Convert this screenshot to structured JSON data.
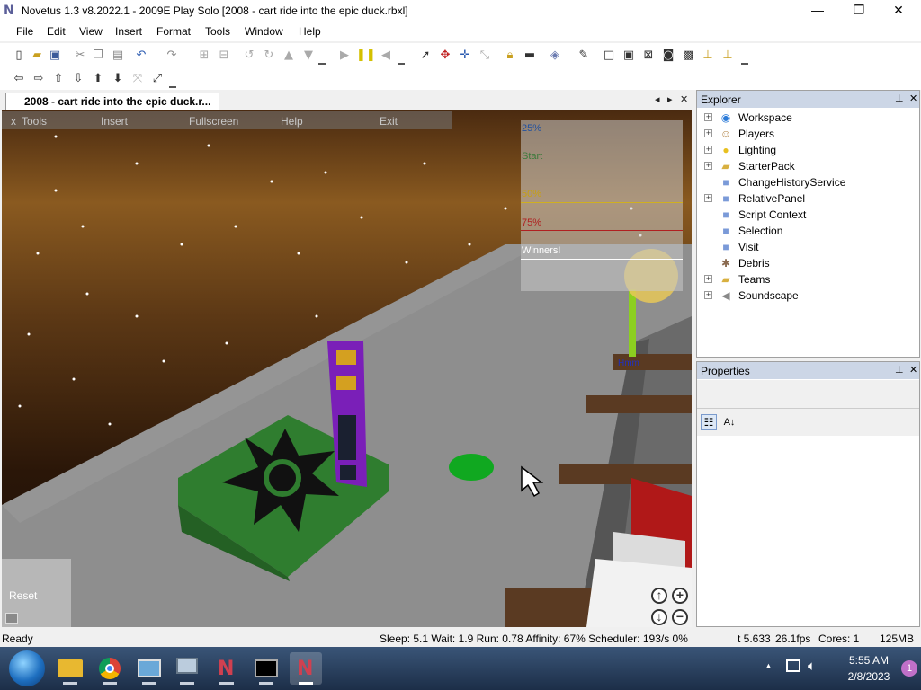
{
  "window": {
    "title": "Novetus 1.3 v8.2022.1 - 2009E Play Solo [2008 - cart ride into the epic duck.rbxl]",
    "app_icon": "N",
    "minimize": "—",
    "maximize": "❐",
    "close": "✕"
  },
  "menu": [
    "File",
    "Edit",
    "View",
    "Insert",
    "Format",
    "Tools",
    "Window",
    "Help"
  ],
  "doc_tab": {
    "label": "2008 - cart ride into the epic duck.r...",
    "prev": "◂",
    "next": "▸",
    "close": "✕"
  },
  "game": {
    "menu": [
      "Tools",
      "Insert",
      "Fullscreen",
      "Help",
      "Exit"
    ],
    "tools_prefix": "x",
    "leaderboard": [
      {
        "label": "25%",
        "color": "#2050a0"
      },
      {
        "label": "Start",
        "color": "#3a7a3a"
      },
      {
        "label": "50%",
        "color": "#d0b020"
      },
      {
        "label": "75%",
        "color": "#b02020"
      },
      {
        "label": "Winners!",
        "color": "#ffffff"
      }
    ],
    "sign_text": "Hmm",
    "reset_label": "Reset",
    "zoom_in": "+",
    "zoom_out": "−",
    "cam_up": "↑",
    "cam_down": "↓"
  },
  "explorer": {
    "title": "Explorer",
    "pin": "⊥",
    "close": "✕",
    "items": [
      {
        "label": "Workspace",
        "icon": "globe-icon",
        "expandable": true
      },
      {
        "label": "Players",
        "icon": "players-icon",
        "expandable": true
      },
      {
        "label": "Lighting",
        "icon": "lightbulb-icon",
        "expandable": true
      },
      {
        "label": "StarterPack",
        "icon": "folder-icon",
        "expandable": true
      },
      {
        "label": "ChangeHistoryService",
        "icon": "service-icon",
        "expandable": false
      },
      {
        "label": "RelativePanel",
        "icon": "service-icon",
        "expandable": true
      },
      {
        "label": "Script Context",
        "icon": "service-icon",
        "expandable": false
      },
      {
        "label": "Selection",
        "icon": "service-icon",
        "expandable": false
      },
      {
        "label": "Visit",
        "icon": "service-icon",
        "expandable": false
      },
      {
        "label": "Debris",
        "icon": "debris-icon",
        "expandable": false
      },
      {
        "label": "Teams",
        "icon": "folder-icon",
        "expandable": true
      },
      {
        "label": "Soundscape",
        "icon": "speaker-icon",
        "expandable": true
      }
    ]
  },
  "properties": {
    "title": "Properties",
    "pin": "⊥",
    "close": "✕",
    "sort_categorized": "☷",
    "sort_alpha": "A↓"
  },
  "status": {
    "left": "Ready",
    "stats": "Sleep: 5.1 Wait: 1.9 Run: 0.78 Affinity: 67% Scheduler: 193/s 0%",
    "time": "t 5.633",
    "fps": "26.1fps",
    "cores": "Cores: 1",
    "memory": "125MB"
  },
  "taskbar": {
    "time": "5:55 AM",
    "date": "2/8/2023",
    "notification_count": "1",
    "tray_arrow": "▲"
  },
  "colors": {
    "panel_header": "#ccd6e6",
    "taskbar": "#1c2e48",
    "purple_tower": "#7a1fb8",
    "green_pad": "#2f7d2f"
  }
}
